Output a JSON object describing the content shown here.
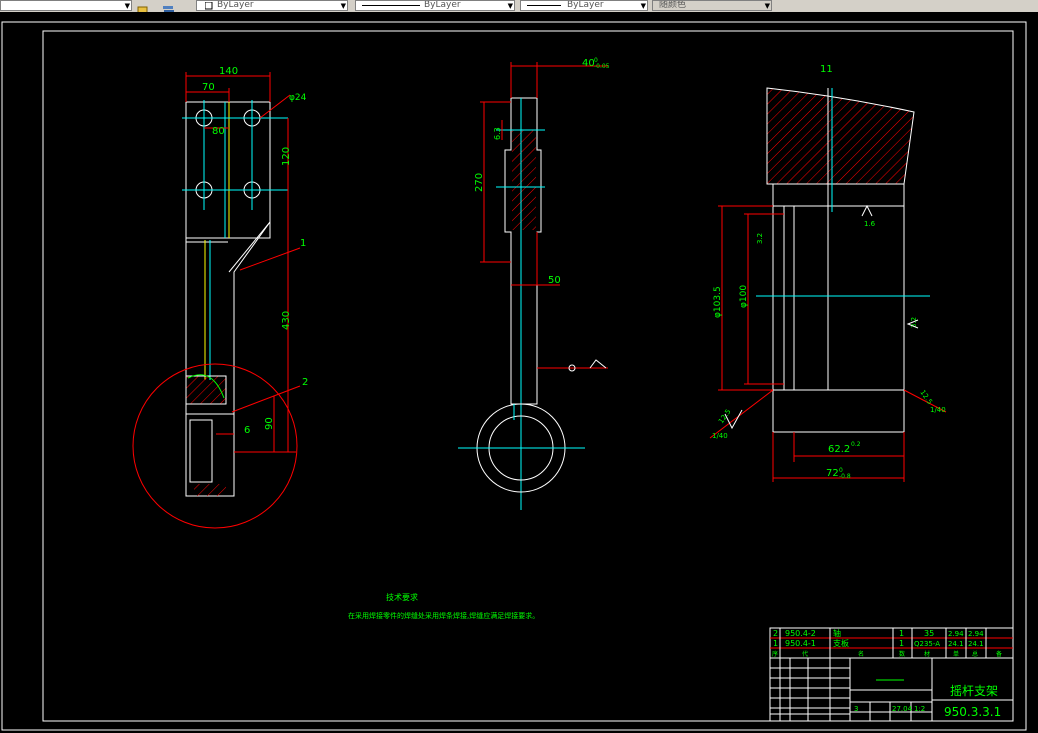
{
  "toolbar": {
    "layer_state": "",
    "color_select": "ByLayer",
    "linetype_select": "ByLayer",
    "lineweight_select": "ByLayer",
    "plotstyle_select": "随颜色"
  },
  "colors": {
    "green": "#00ff00",
    "cyan": "#00ffff",
    "red": "#ff0000",
    "white": "#ffffff",
    "yellow": "#ffff00",
    "bg": "#000000"
  },
  "drawing": {
    "dims": {
      "w140": "140",
      "w70": "70",
      "w80": "80",
      "phi24": "φ24",
      "h120": "120",
      "h430": "430",
      "h90": "90",
      "d6": "6",
      "label1": "1",
      "label2": "2",
      "w40": "40",
      "w40_tol_up": "0",
      "w40_tol_dn": "-0.05",
      "h270": "270",
      "r65": "6.3",
      "w50": "50",
      "section": "11",
      "phi1035": "φ103.5",
      "phi100": "φ100",
      "w622": "62.2",
      "w622_tol": "0.2",
      "w72": "72",
      "w72_tol_up": "0",
      "w72_tol_dn": "-0.8",
      "rough16": "1.6",
      "rough32": "3.2",
      "rough128": "12.5",
      "left_mark": "1/40",
      "right_mark": "1/40"
    },
    "tech_title": "技术要求",
    "tech_text": "在采用焊接零件的焊缝处采用焊条焊接,焊缝应满足焊接要求。",
    "title_block": {
      "rows": [
        {
          "no": "2",
          "code": "950.4-2",
          "name": "轴",
          "qty": "1",
          "mat": "35",
          "w1": "2.94",
          "w2": "2.94"
        },
        {
          "no": "1",
          "code": "950.4-1",
          "name": "支板",
          "qty": "1",
          "mat": "Q235-A",
          "w1": "24.1",
          "w2": "24.1"
        }
      ],
      "header": [
        "序",
        "代",
        "名",
        "数",
        "材",
        "单",
        "总",
        "备"
      ],
      "part_name": "摇杆支架",
      "part_code": "950.3.3.1",
      "scale": "1:2",
      "weight": "27.04",
      "sheet": "3"
    }
  }
}
